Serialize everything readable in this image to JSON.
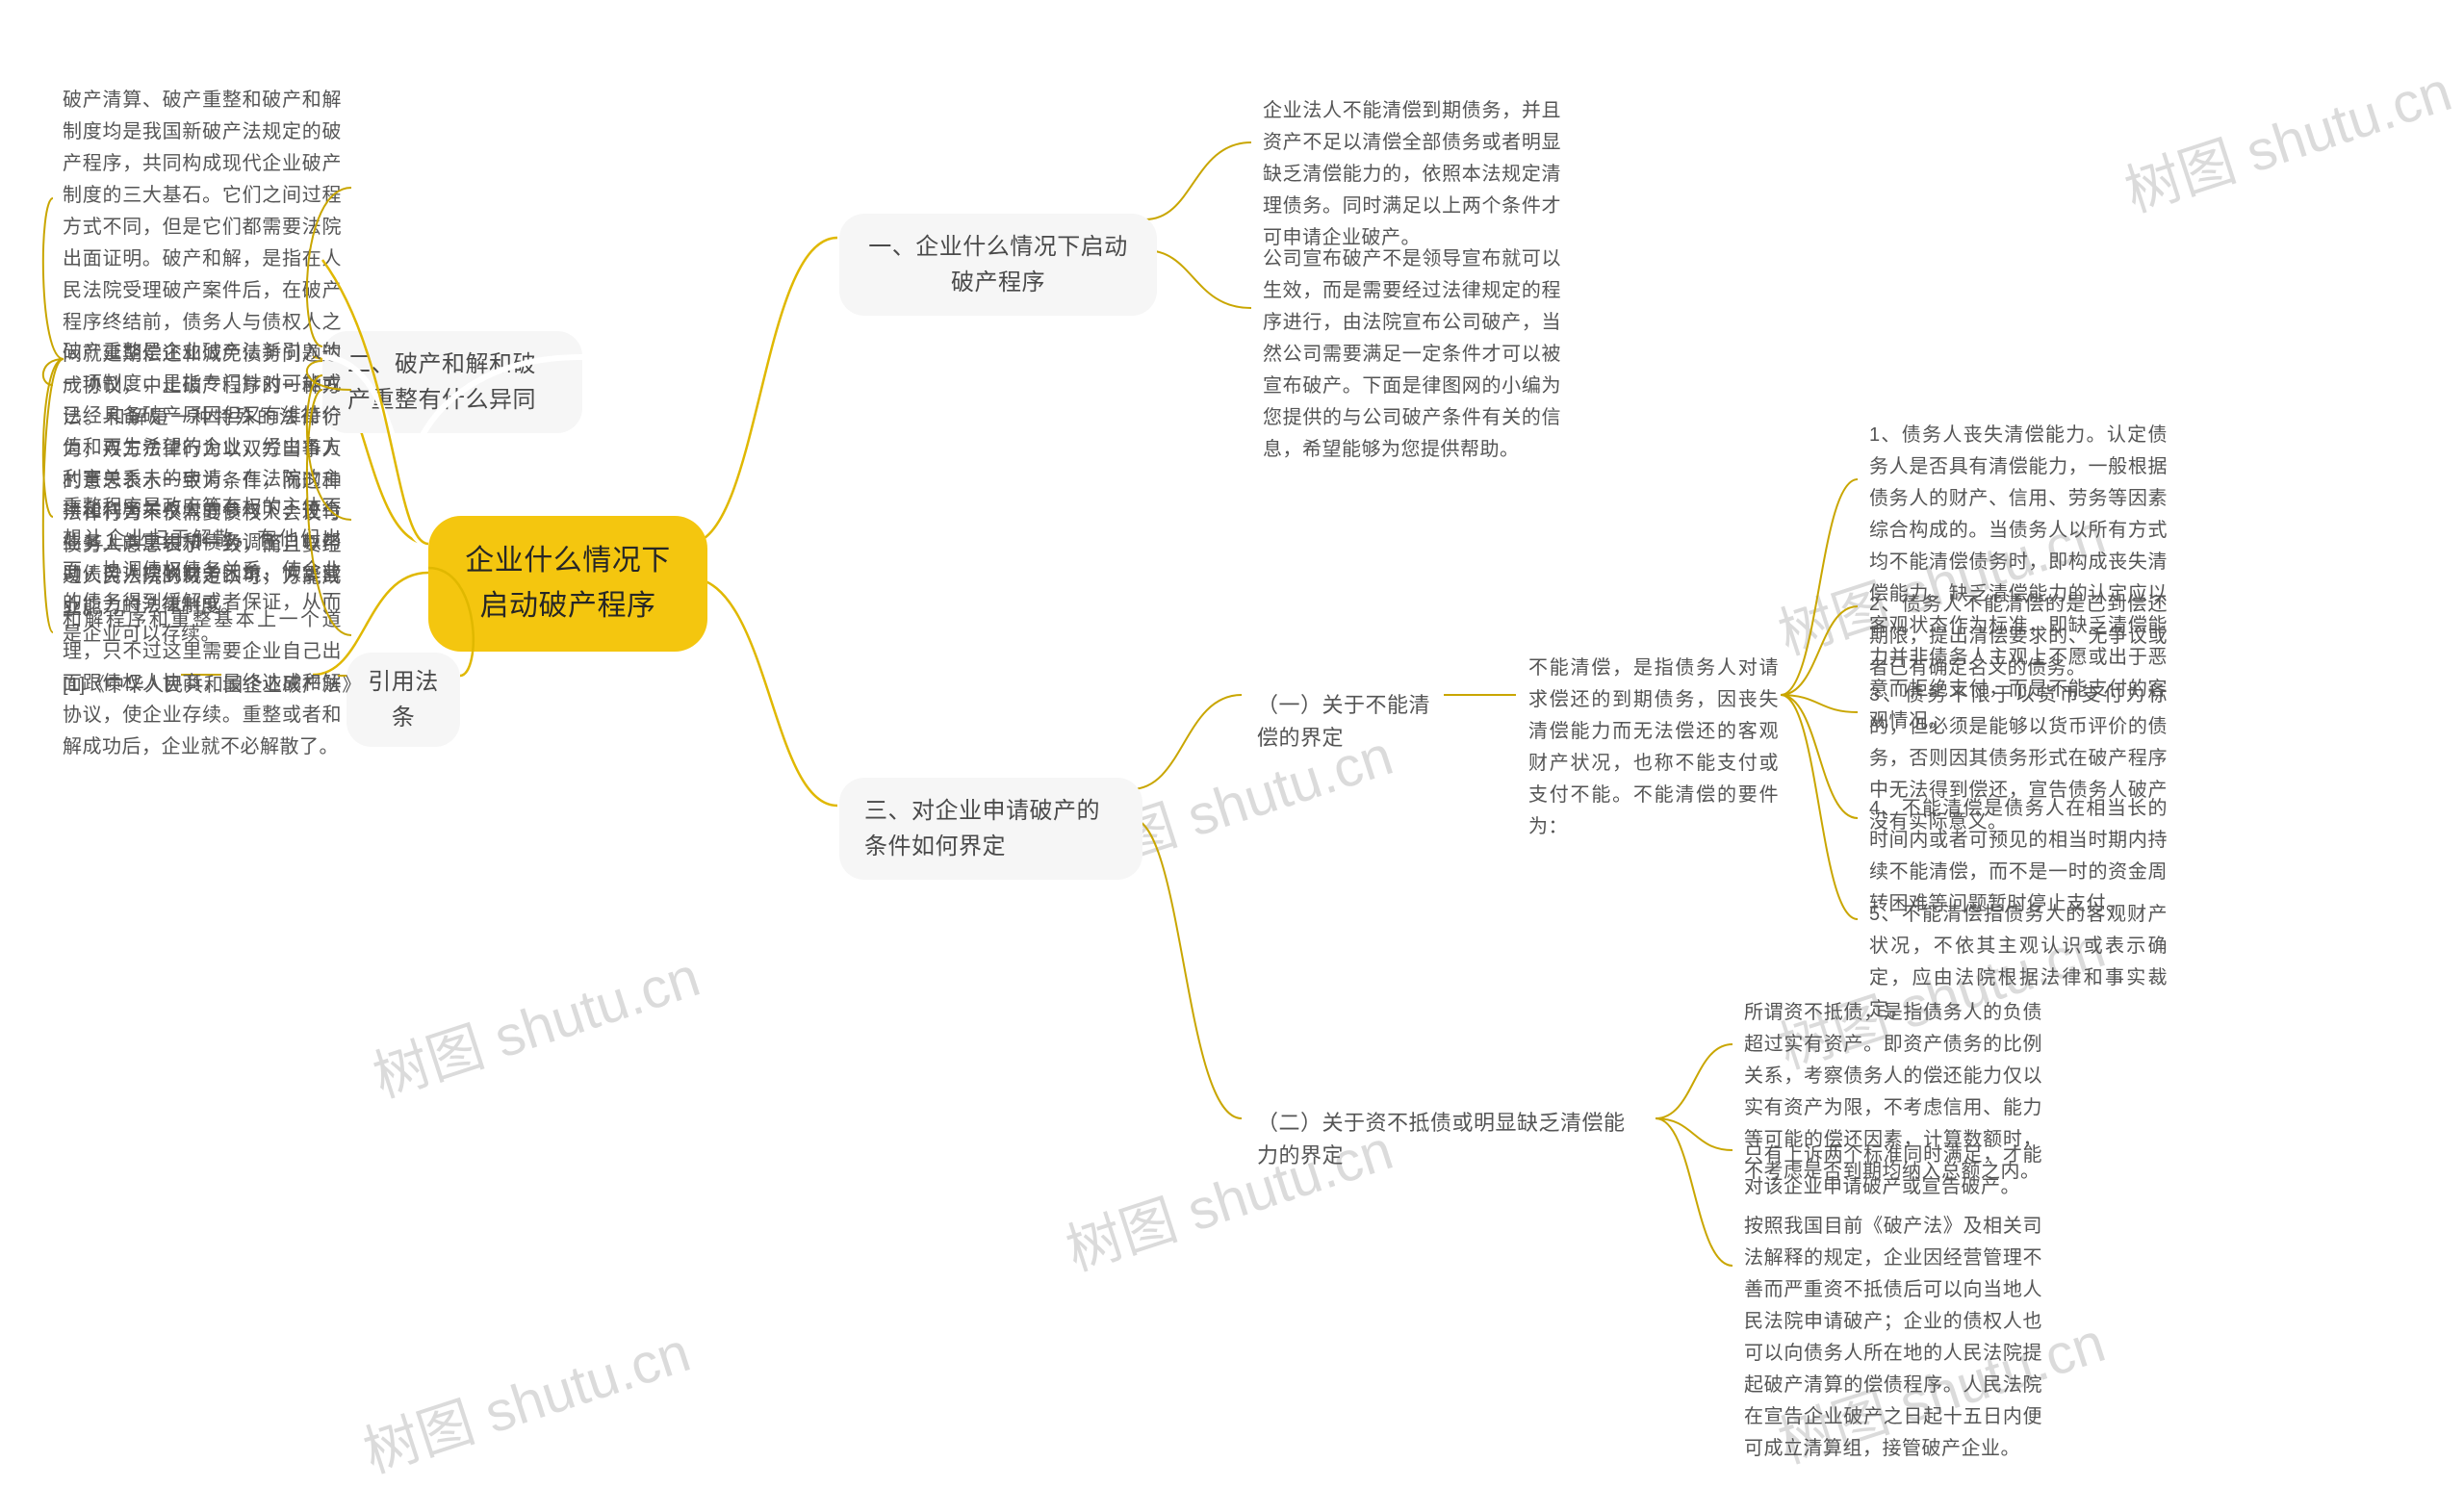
{
  "watermark": "树图 shutu.cn",
  "root": {
    "text": "企业什么情况下启动破产程序"
  },
  "branch1": {
    "title": "一、企业什么情况下启动破产程序",
    "leaf1": "企业法人不能清偿到期债务，并且资产不足以清偿全部债务或者明显缺乏清偿能力的，依照本法规定清理债务。同时满足以上两个条件才可申请企业破产。",
    "leaf2": "公司宣布破产不是领导宣布就可以生效，而是需要经过法律规定的程序进行，由法院宣布公司破产，当然公司需要满足一定条件才可以被宣布破产。下面是律图网的小编为您提供的与公司破产条件有关的信息，希望能够为您提供帮助。"
  },
  "branch2": {
    "title": "二、破产和解和破产重整有什么异同",
    "leaf1": "破产清算、破产重整和破产和解制度均是我国新破产法规定的破产程序，共同构成现代企业破产制度的三大基石。它们之间过程方式不同，但是它们都需要法院出面证明。破产和解，是指在人民法院受理破产案件后，在破产程序终结前，债务人与债权人之间就延期偿还和减免债务问题达成协议，中止破产程序的一种方法。和解是一种特殊的法律行为，双方法律行为以双方当事人的意思表示一致为条件，而这种法律行为不仅需要债权人会议与债务人意思表示一致，而且要经过人民法院的裁定认可，方能成立。",
    "leaf2": "破产重整是企业破产法新引入的一项制度，是指专门针对可能或已经具备破产原因但又有维持价值和再生希望的企业，经由各方利害关系人的申请，在法院的主持和利害关系人的参与下，进行业务上的重组和债务调整，以帮助债务人摆脱财务困境、恢复营业能力的法律制度。",
    "leaf3": "重整程序是政府等有权的主体不想让企业归于解散，有他们出面，协调债权债务关系，使企业的债务得到缓解或者保证，从而是企业可以存续。",
    "leaf4": "和解程序和重整基本上一个道理，只不过这里需要企业自己出面跟债权人协商，最终达成和解协议，使企业存续。重整或者和解成功后，企业就不必解散了。"
  },
  "branch3": {
    "title": "三、对企业申请破产的条件如何界定",
    "sub1": {
      "title": "（一）关于不能清偿的界定",
      "intro": "不能清偿，是指债务人对请求偿还的到期债务，因丧失清偿能力而无法偿还的客观财产状况，也称不能支付或支付不能。不能清偿的要件为：",
      "leaf1": "1、债务人丧失清偿能力。认定债务人是否具有清偿能力，一般根据债务人的财产、信用、劳务等因素综合构成的。当债务人以所有方式均不能清偿债务时，即构成丧失清偿能力。缺乏清偿能力的认定应以客观状态作为标准，即缺乏清偿能力并非债务人主观上不愿或出于恶意而拒绝支付，而是不能支付的客观情况。",
      "leaf2": "2、债务人不能清偿的是已到偿还期限，提出清偿要求的、无争议或者已有确定名义的债务。",
      "leaf3": "3、债务不限于以货币支付为标的，但必须是能够以货币评价的债务，否则因其债务形式在破产程序中无法得到偿还，宣告债务人破产没有实际意义。",
      "leaf4": "4、不能清偿是债务人在相当长的时间内或者可预见的相当时期内持续不能清偿，而不是一时的资金周转困难等问题暂时停止支付。",
      "leaf5": "5、不能清偿指债务人的客观财产状况，不依其主观认识或表示确定，应由法院根据法律和事实裁定。"
    },
    "sub2": {
      "title": "（二）关于资不抵债或明显缺乏清偿能力的界定",
      "leaf1": "所谓资不抵债，是指债务人的负债超过实有资产。即资产债务的比例关系，考察债务人的偿还能力仅以实有资产为限，不考虑信用、能力等可能的偿还因素，计算数额时，不考虑是否到期均纳入总额之内。",
      "leaf2": "只有上诉两个标准同时满足，才能对该企业申请破产或宣告破产。",
      "leaf3": "按照我国目前《破产法》及相关司法解释的规定，企业因经营管理不善而严重资不抵债后可以向当地人民法院申请破产；企业的债权人也可以向债务人所在地的人民法院提起破产清算的偿债程序。人民法院在宣告企业破产之日起十五日内便可成立清算组，接管破产企业。"
    }
  },
  "branch4": {
    "title": "引用法条",
    "leaf1": "[1]《中华人民共和国企业破产法》"
  }
}
